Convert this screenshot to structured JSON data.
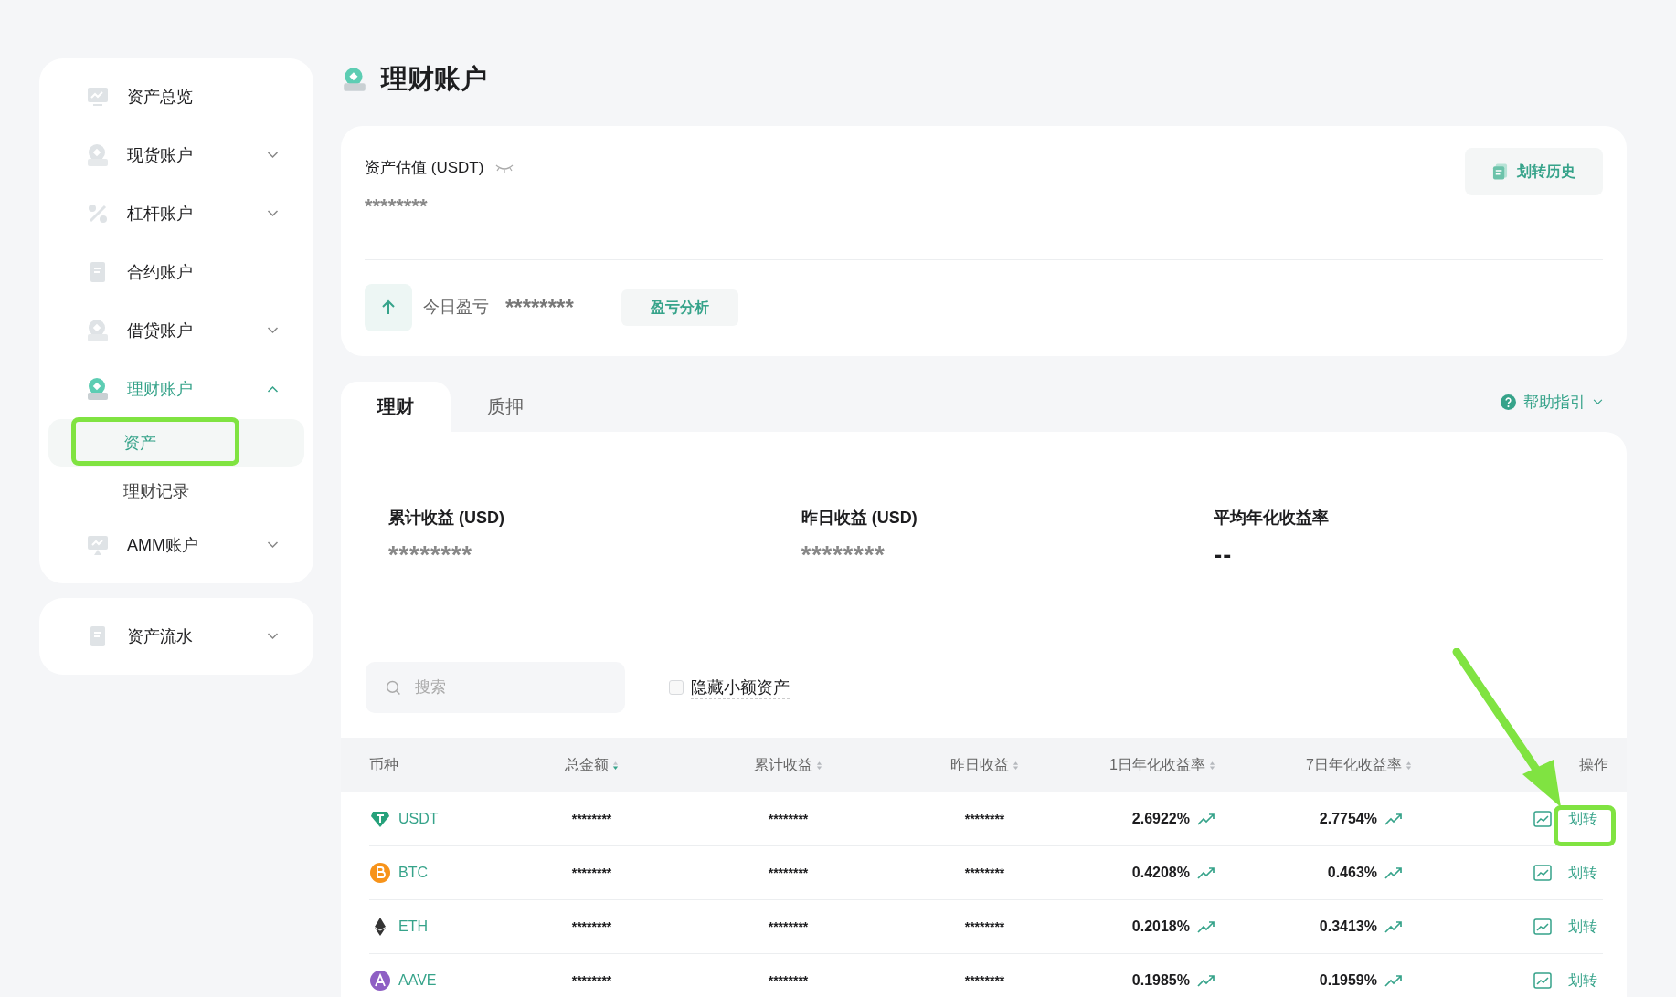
{
  "sidebar": {
    "groups": [
      {
        "items": [
          {
            "label": "资产总览",
            "selected": false
          },
          {
            "label": "现货账户",
            "selected": false,
            "expanded": false
          },
          {
            "label": "杠杆账户",
            "selected": false,
            "expanded": false
          },
          {
            "label": "合约账户",
            "selected": false
          },
          {
            "label": "借贷账户",
            "selected": false,
            "expanded": false
          },
          {
            "label": "理财账户",
            "selected": true,
            "expanded": true,
            "children": [
              {
                "label": "资产",
                "selected": true
              },
              {
                "label": "理财记录",
                "selected": false
              }
            ]
          },
          {
            "label": "AMM账户",
            "selected": false,
            "expanded": false
          }
        ]
      },
      {
        "items": [
          {
            "label": "资产流水",
            "selected": false,
            "expanded": false
          }
        ]
      }
    ]
  },
  "page_title": "理财账户",
  "summary": {
    "label": "资产估值 (USDT)",
    "value": "********",
    "history_button": "划转历史",
    "today_pnl_label": "今日盈亏",
    "today_pnl_value": "********",
    "analysis_button": "盈亏分析"
  },
  "tabs": [
    {
      "label": "理财",
      "selected": true
    },
    {
      "label": "质押",
      "selected": false
    }
  ],
  "help": "帮助指引",
  "stats": [
    {
      "label": "累计收益 (USD)",
      "value": "********"
    },
    {
      "label": "昨日收益 (USD)",
      "value": "********"
    },
    {
      "label": "平均年化收益率",
      "value": "--"
    }
  ],
  "search": {
    "placeholder": "搜索"
  },
  "hide_small": {
    "label": "隐藏小额资产",
    "checked": false
  },
  "table": {
    "columns": [
      {
        "label": "币种"
      },
      {
        "label": "总金额",
        "sorted": true
      },
      {
        "label": "累计收益",
        "sorted": false
      },
      {
        "label": "昨日收益",
        "sorted": false
      },
      {
        "label": "1日年化收益率",
        "sorted": false
      },
      {
        "label": "7日年化收益率",
        "sorted": false
      },
      {
        "label": "操作"
      }
    ],
    "rows": [
      {
        "coin": "USDT",
        "color": "#26a17b",
        "total": "********",
        "cumulative": "********",
        "yesterday": "********",
        "rate_1d": "2.6922%",
        "rate_7d": "2.7754%",
        "action": "划转"
      },
      {
        "coin": "BTC",
        "color": "#f7931a",
        "total": "********",
        "cumulative": "********",
        "yesterday": "********",
        "rate_1d": "0.4208%",
        "rate_7d": "0.463%",
        "action": "划转"
      },
      {
        "coin": "ETH",
        "color": "#343434",
        "total": "********",
        "cumulative": "********",
        "yesterday": "********",
        "rate_1d": "0.2018%",
        "rate_7d": "0.3413%",
        "action": "划转"
      },
      {
        "coin": "AAVE",
        "color": "#8e5fc4",
        "total": "********",
        "cumulative": "********",
        "yesterday": "********",
        "rate_1d": "0.1985%",
        "rate_7d": "0.1959%",
        "action": "划转"
      }
    ]
  }
}
